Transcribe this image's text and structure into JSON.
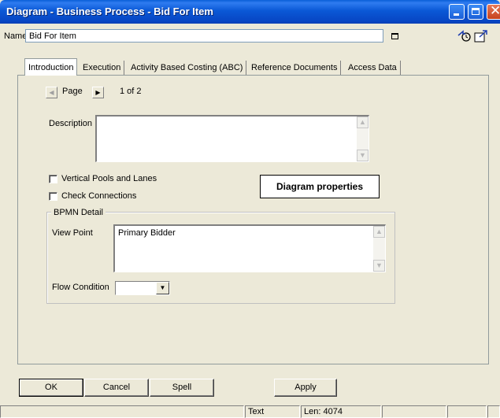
{
  "window": {
    "title": "Diagram - Business Process - Bid For Item"
  },
  "name_row": {
    "label": "Name",
    "value": "Bid For Item"
  },
  "tabs": [
    {
      "label": "Introduction",
      "active": true
    },
    {
      "label": "Execution",
      "active": false
    },
    {
      "label": "Activity Based Costing (ABC)",
      "active": false
    },
    {
      "label": "Reference Documents",
      "active": false
    },
    {
      "label": "Access Data",
      "active": false
    }
  ],
  "pager": {
    "label": "Page",
    "count": "1 of 2"
  },
  "description": {
    "label": "Description",
    "value": ""
  },
  "checkboxes": {
    "vertical_pools": {
      "label": "Vertical Pools and Lanes",
      "checked": false
    },
    "check_connections": {
      "label": "Check Connections",
      "checked": false
    }
  },
  "diagram_properties_label": "Diagram properties",
  "bpmn": {
    "legend": "BPMN Detail",
    "view_point_label": "View Point",
    "view_point_value": "Primary Bidder",
    "flow_condition_label": "Flow Condition",
    "flow_condition_value": ""
  },
  "buttons": {
    "ok": "OK",
    "cancel": "Cancel",
    "spell": "Spell",
    "apply": "Apply"
  },
  "status": {
    "mode": "Text",
    "length": "Len: 4074"
  },
  "colors": {
    "titlebar": "#0a58d6",
    "dialog_bg": "#ece9d8",
    "close_button": "#c5421c"
  }
}
